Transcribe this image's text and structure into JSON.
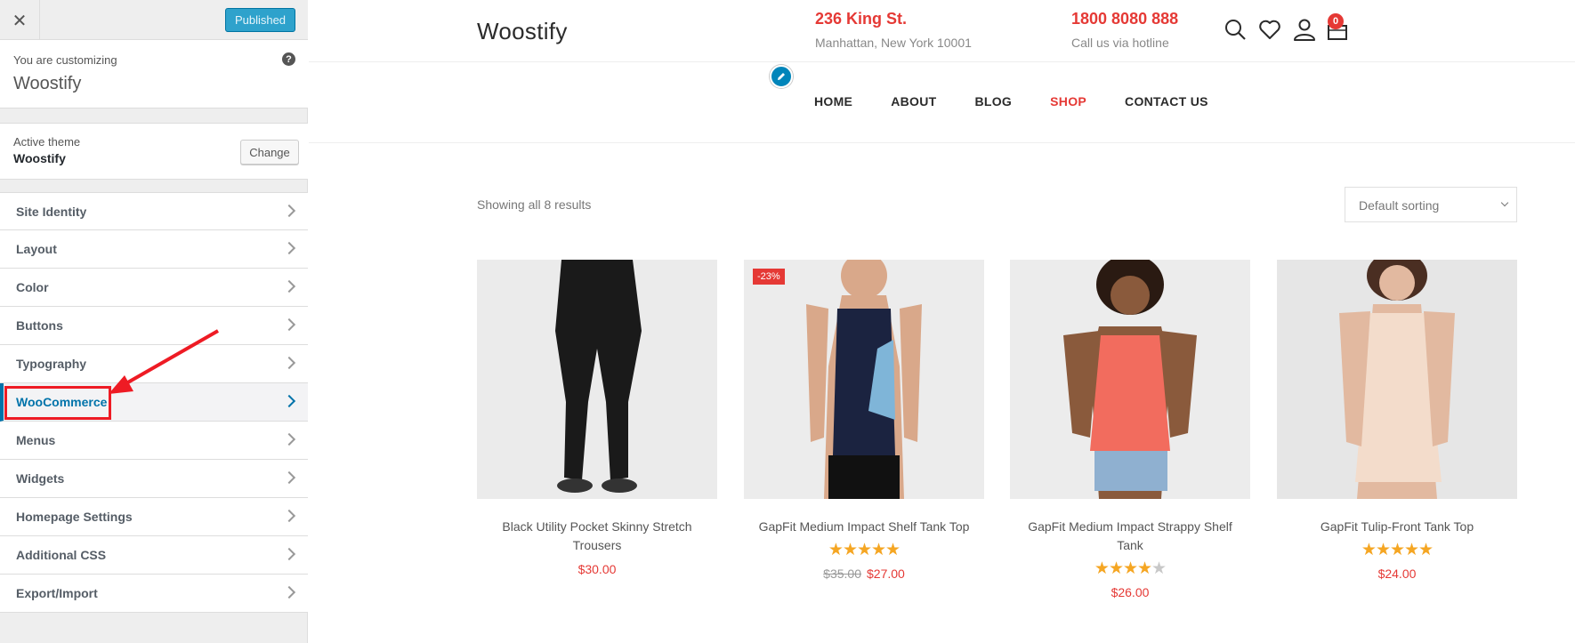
{
  "customizer": {
    "close_icon": "close-icon",
    "published_label": "Published",
    "customizing_label": "You are customizing",
    "site_name": "Woostify",
    "help_icon": "?",
    "active_theme_label": "Active theme",
    "active_theme_name": "Woostify",
    "change_label": "Change",
    "menu": [
      {
        "label": "Site Identity"
      },
      {
        "label": "Layout"
      },
      {
        "label": "Color"
      },
      {
        "label": "Buttons"
      },
      {
        "label": "Typography"
      },
      {
        "label": "WooCommerce",
        "active": true
      },
      {
        "label": "Menus"
      },
      {
        "label": "Widgets"
      },
      {
        "label": "Homepage Settings"
      },
      {
        "label": "Additional CSS"
      },
      {
        "label": "Export/Import"
      }
    ],
    "accent_color": "#0073aa",
    "highlight_color": "#ee1b24"
  },
  "site": {
    "logo": "Woostify",
    "address_title": "236 King St.",
    "address_sub": "Manhattan, New York 10001",
    "phone_title": "1800 8080 888",
    "phone_sub": "Call us via hotline",
    "cart_count": "0",
    "icons": [
      "search-icon",
      "heart-icon",
      "user-icon",
      "cart-icon"
    ],
    "nav": [
      {
        "label": "HOME"
      },
      {
        "label": "ABOUT"
      },
      {
        "label": "BLOG"
      },
      {
        "label": "SHOP",
        "current": true
      },
      {
        "label": "CONTACT US"
      }
    ],
    "accent_color": "#e53935"
  },
  "shop": {
    "result_count": "Showing all 8 results",
    "sorting": "Default sorting",
    "products": [
      {
        "title": "Black Utility Pocket Skinny Stretch Trousers",
        "price": "$30.00",
        "rating": null
      },
      {
        "title": "GapFit Medium Impact Shelf Tank Top",
        "badge": "-23%",
        "old_price": "$35.00",
        "price": "$27.00",
        "rating": 5
      },
      {
        "title": "GapFit Medium Impact Strappy Shelf Tank",
        "price": "$26.00",
        "rating": 4.5
      },
      {
        "title": "GapFit Tulip-Front Tank Top",
        "price": "$24.00",
        "rating": 5
      }
    ]
  }
}
